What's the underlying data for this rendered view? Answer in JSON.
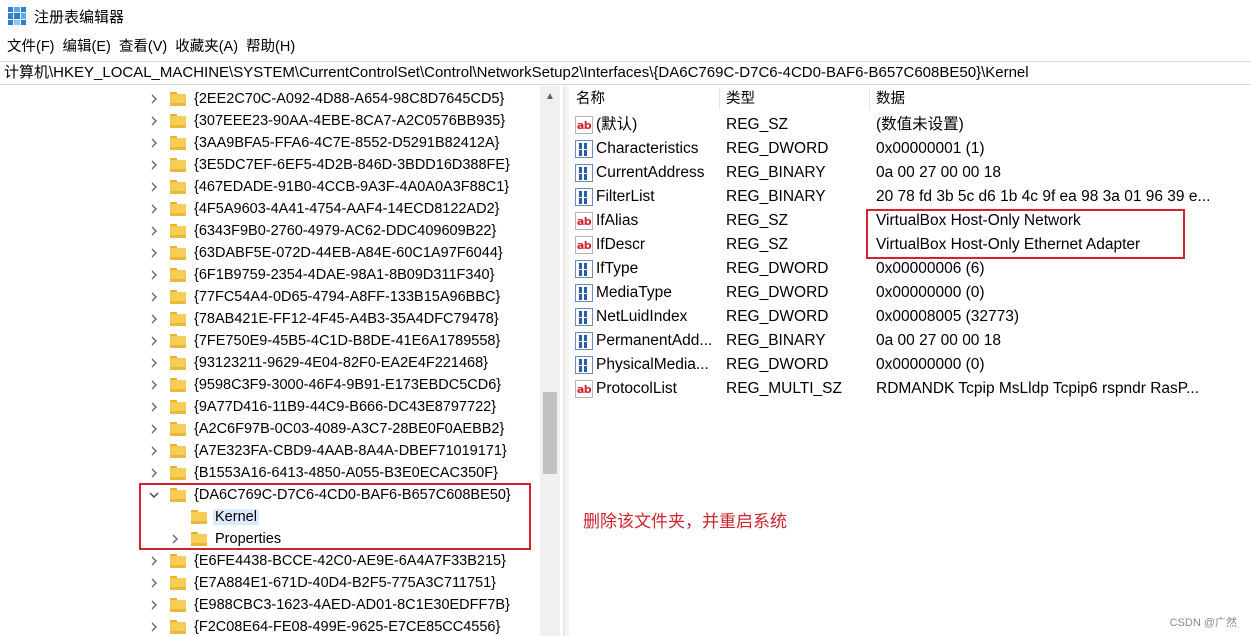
{
  "window": {
    "title": "注册表编辑器",
    "app_icon": "registry-editor-icon"
  },
  "menu": [
    "文件(F)",
    "编辑(E)",
    "查看(V)",
    "收藏夹(A)",
    "帮助(H)"
  ],
  "address": "计算机\\HKEY_LOCAL_MACHINE\\SYSTEM\\CurrentControlSet\\Control\\NetworkSetup2\\Interfaces\\{DA6C769C-D7C6-4CD0-BAF6-B657C608BE50}\\Kernel",
  "tree": {
    "items": [
      {
        "label": "{2EE2C70C-A092-4D88-A654-98C8D7645CD5}",
        "state": "collapsed"
      },
      {
        "label": "{307EEE23-90AA-4EBE-8CA7-A2C0576BB935}",
        "state": "collapsed"
      },
      {
        "label": "{3AA9BFA5-FFA6-4C7E-8552-D5291B82412A}",
        "state": "collapsed"
      },
      {
        "label": "{3E5DC7EF-6EF5-4D2B-846D-3BDD16D388FE}",
        "state": "collapsed"
      },
      {
        "label": "{467EDADE-91B0-4CCB-9A3F-4A0A0A3F88C1}",
        "state": "collapsed"
      },
      {
        "label": "{4F5A9603-4A41-4754-AAF4-14ECD8122AD2}",
        "state": "collapsed"
      },
      {
        "label": "{6343F9B0-2760-4979-AC62-DDC409609B22}",
        "state": "collapsed"
      },
      {
        "label": "{63DABF5E-072D-44EB-A84E-60C1A97F6044}",
        "state": "collapsed"
      },
      {
        "label": "{6F1B9759-2354-4DAE-98A1-8B09D311F340}",
        "state": "collapsed"
      },
      {
        "label": "{77FC54A4-0D65-4794-A8FF-133B15A96BBC}",
        "state": "collapsed"
      },
      {
        "label": "{78AB421E-FF12-4F45-A4B3-35A4DFC79478}",
        "state": "collapsed"
      },
      {
        "label": "{7FE750E9-45B5-4C1D-B8DE-41E6A1789558}",
        "state": "collapsed"
      },
      {
        "label": "{93123211-9629-4E04-82F0-EA2E4F221468}",
        "state": "collapsed"
      },
      {
        "label": "{9598C3F9-3000-46F4-9B91-E173EBDC5CD6}",
        "state": "collapsed"
      },
      {
        "label": "{9A77D416-11B9-44C9-B666-DC43E8797722}",
        "state": "collapsed"
      },
      {
        "label": "{A2C6F97B-0C03-4089-A3C7-28BE0F0AEBB2}",
        "state": "collapsed"
      },
      {
        "label": "{A7E323FA-CBD9-4AAB-8A4A-DBEF71019171}",
        "state": "collapsed"
      },
      {
        "label": "{B1553A16-6413-4850-A055-B3E0ECAC350F}",
        "state": "collapsed"
      },
      {
        "label": "{DA6C769C-D7C6-4CD0-BAF6-B657C608BE50}",
        "state": "expanded"
      },
      {
        "label": "Kernel",
        "state": "selected-child"
      },
      {
        "label": "Properties",
        "state": "child"
      },
      {
        "label": "{E6FE4438-BCCE-42C0-AE9E-6A4A7F33B215}",
        "state": "collapsed"
      },
      {
        "label": "{E7A884E1-671D-40D4-B2F5-775A3C711751}",
        "state": "collapsed"
      },
      {
        "label": "{E988CBC3-1623-4AED-AD01-8C1E30EDFF7B}",
        "state": "collapsed"
      },
      {
        "label": "{F2C08E64-FE08-499E-9625-E7CE85CC4556}",
        "state": "collapsed"
      }
    ]
  },
  "values": {
    "columns": [
      "名称",
      "类型",
      "数据"
    ],
    "rows": [
      {
        "icon": "string-value-icon",
        "name": "(默认)",
        "type": "REG_SZ",
        "data": "(数值未设置)"
      },
      {
        "icon": "binary-value-icon",
        "name": "Characteristics",
        "type": "REG_DWORD",
        "data": "0x00000001 (1)"
      },
      {
        "icon": "binary-value-icon",
        "name": "CurrentAddress",
        "type": "REG_BINARY",
        "data": "0a 00 27 00 00 18"
      },
      {
        "icon": "binary-value-icon",
        "name": "FilterList",
        "type": "REG_BINARY",
        "data": "20 78 fd 3b 5c d6 1b 4c 9f ea 98 3a 01 96 39 e..."
      },
      {
        "icon": "string-value-icon",
        "name": "IfAlias",
        "type": "REG_SZ",
        "data": "VirtualBox Host-Only Network"
      },
      {
        "icon": "string-value-icon",
        "name": "IfDescr",
        "type": "REG_SZ",
        "data": "VirtualBox Host-Only Ethernet Adapter"
      },
      {
        "icon": "binary-value-icon",
        "name": "IfType",
        "type": "REG_DWORD",
        "data": "0x00000006 (6)"
      },
      {
        "icon": "binary-value-icon",
        "name": "MediaType",
        "type": "REG_DWORD",
        "data": "0x00000000 (0)"
      },
      {
        "icon": "binary-value-icon",
        "name": "NetLuidIndex",
        "type": "REG_DWORD",
        "data": "0x00008005 (32773)"
      },
      {
        "icon": "binary-value-icon",
        "name": "PermanentAdd...",
        "type": "REG_BINARY",
        "data": "0a 00 27 00 00 18"
      },
      {
        "icon": "binary-value-icon",
        "name": "PhysicalMedia...",
        "type": "REG_DWORD",
        "data": "0x00000000 (0)"
      },
      {
        "icon": "string-value-icon",
        "name": "ProtocolList",
        "type": "REG_MULTI_SZ",
        "data": "RDMANDK Tcpip MsLldp Tcpip6 rspndr RasP..."
      }
    ]
  },
  "annotation": "删除该文件夹，并重启系统",
  "watermark": "CSDN @广然",
  "colors": {
    "highlight_box": "#d1232d",
    "selection": "#dcebfc"
  }
}
